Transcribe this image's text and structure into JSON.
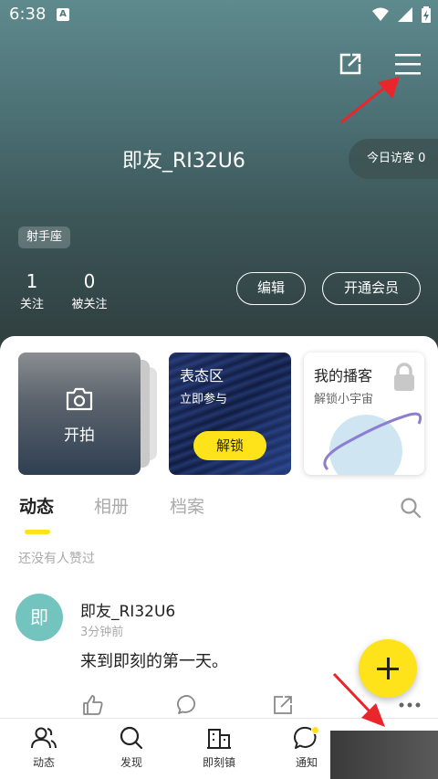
{
  "status_bar": {
    "time": "6:38",
    "notif_letter": "A"
  },
  "profile": {
    "username": "即友_RI32U6",
    "visitor_text": "今日访客 0",
    "zodiac": "射手座",
    "stats": [
      {
        "num": "1",
        "label": "关注"
      },
      {
        "num": "0",
        "label": "被关注"
      }
    ],
    "edit_label": "编辑",
    "vip_label": "开通会员"
  },
  "cards": {
    "shoot_label": "开拍",
    "expression_title": "表态区",
    "expression_sub": "立即参与",
    "unlock_label": "解锁",
    "podcast_title": "我的播客",
    "podcast_sub": "解锁小宇宙"
  },
  "tabs": [
    "动态",
    "相册",
    "档案"
  ],
  "no_likes_text": "还没有人赞过",
  "post": {
    "avatar_char": "即",
    "author": "即友_RI32U6",
    "time": "3分钟前",
    "content": "来到即刻的第一天。"
  },
  "bottom_nav": [
    {
      "label": "动态",
      "icon": "people-icon"
    },
    {
      "label": "发现",
      "icon": "search-icon"
    },
    {
      "label": "即刻镇",
      "icon": "town-icon"
    },
    {
      "label": "通知",
      "icon": "chat-bubble-icon"
    }
  ],
  "colors": {
    "accent": "#fee31a",
    "avatar": "#73c4bf",
    "arrow": "#e8262b"
  }
}
